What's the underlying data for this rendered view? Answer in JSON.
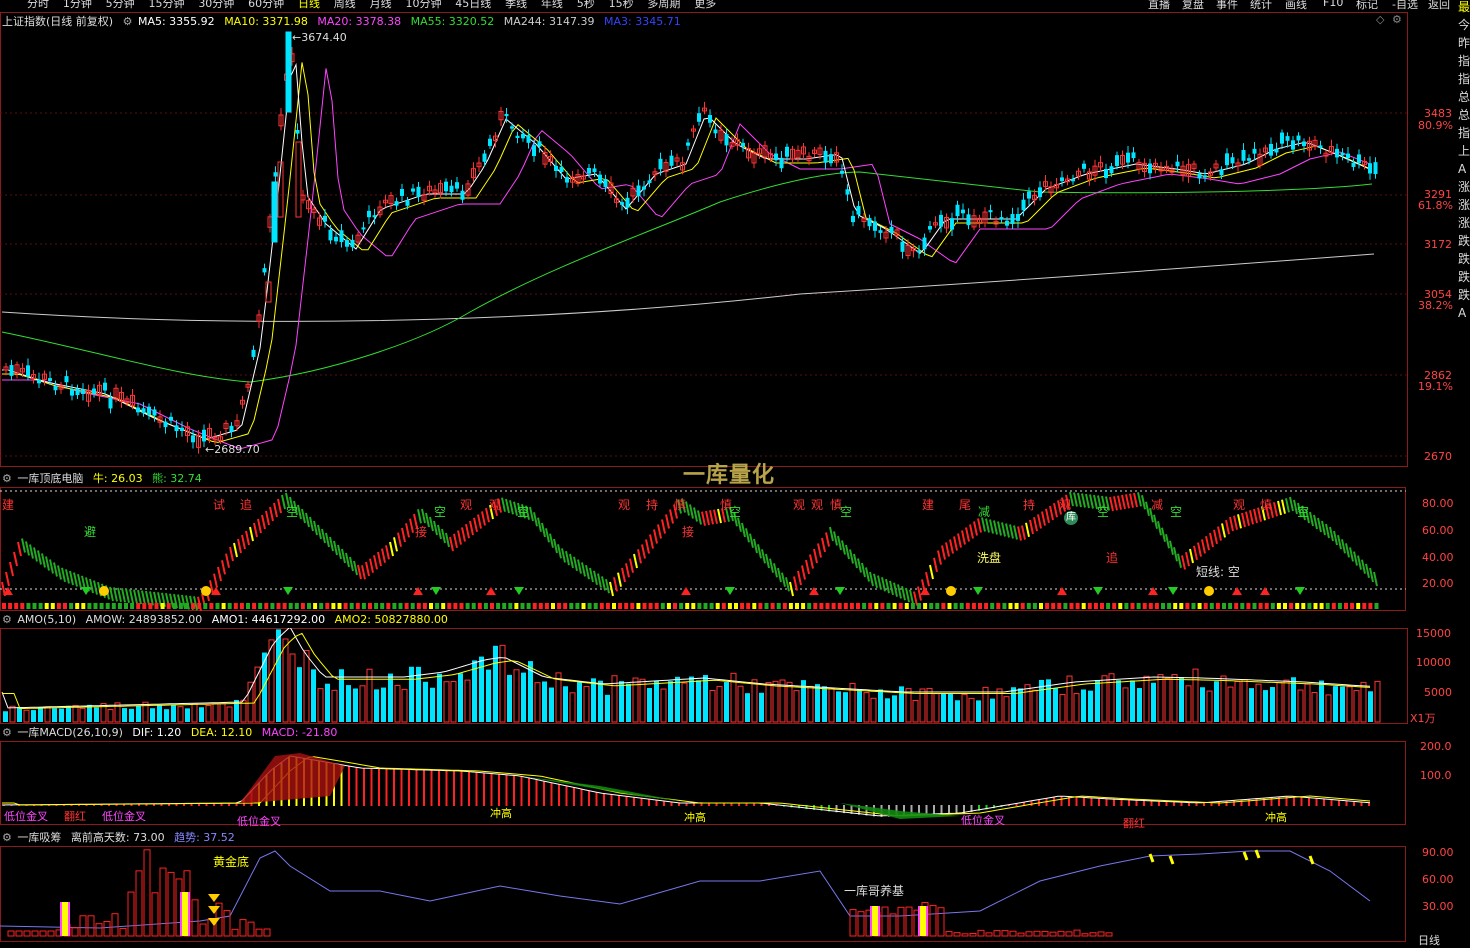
{
  "top_tabs": [
    "分时",
    "1分钟",
    "5分钟",
    "15分钟",
    "30分钟",
    "60分钟",
    "日线",
    "周线",
    "月线",
    "10分钟",
    "45日线",
    "季线",
    "年线",
    "5秒",
    "15秒",
    "多周期",
    "更多"
  ],
  "active_tab": "日线",
  "top_buttons": [
    "直播",
    "复盘",
    "事件",
    "统计",
    "画线",
    "F10",
    "标记",
    "-自选",
    "返回"
  ],
  "main": {
    "title": "上证指数(日线 前复权)",
    "ma": [
      {
        "label": "MA5: 3355.92",
        "color": "#ffffff"
      },
      {
        "label": "MA10: 3371.98",
        "color": "#ffff00"
      },
      {
        "label": "MA20: 3378.38",
        "color": "#ff44ff"
      },
      {
        "label": "MA55: 3320.52",
        "color": "#33dd33"
      },
      {
        "label": "MA244: 3147.39",
        "color": "#cccccc"
      },
      {
        "label": "MA3: 3345.71",
        "color": "#3333ff"
      }
    ],
    "high_label": "3674.40",
    "low_label": "2689.70",
    "price_ticks": [
      "3483",
      "3291",
      "3172",
      "3054",
      "2862",
      "2670"
    ],
    "pct_ticks": [
      "80.9%",
      "61.8%",
      "38.2%",
      "19.1%"
    ]
  },
  "watermark": "一库量化",
  "ind1": {
    "title": "一库顶底电脑",
    "bull": "牛: 26.03",
    "bear": "熊: 32.74",
    "ticks": [
      "80.00",
      "60.00",
      "40.00",
      "20.00"
    ],
    "labels_red": [
      "建",
      "试",
      "追",
      "观",
      "观",
      "持",
      "慎",
      "慎",
      "观",
      "观",
      "慎",
      "建",
      "尾",
      "持",
      "观",
      "减",
      "观",
      "慎"
    ],
    "labels_green": [
      "避",
      "空",
      "空",
      "空",
      "空",
      "空",
      "空",
      "空"
    ],
    "labels_mixed": [
      "接",
      "接",
      "减",
      "库"
    ],
    "wash": "洗盘",
    "chase": "追",
    "short_line": "短线: 空"
  },
  "amo": {
    "title": "AMO(5,10)",
    "amow": "AMOW: 24893852.00",
    "amo1": "AMO1: 44617292.00",
    "amo2": "AMO2: 50827880.00",
    "ticks": [
      "15000",
      "10000",
      "5000"
    ],
    "unit": "X1万"
  },
  "macd": {
    "title": "一库MACD(26,10,9)",
    "dif": "DIF: 1.20",
    "dea": "DEA: 12.10",
    "macd": "MACD: -21.80",
    "ticks": [
      "200.0",
      "100.0"
    ],
    "labels": [
      "低位金叉",
      "翻红",
      "低位金叉",
      "低位金叉",
      "冲高",
      "冲高",
      "低位金叉",
      "翻红",
      "冲高"
    ]
  },
  "chip": {
    "title": "一库吸筹",
    "days": "离前高天数: 73.00",
    "trend": "趋势: 37.52",
    "ticks": [
      "90.00",
      "60.00",
      "30.00"
    ],
    "golden": "黄金底",
    "brother": "一库哥养基"
  },
  "bottom_tab": "日线",
  "right_side": [
    "最",
    "今",
    "昨",
    "指",
    "指",
    "总",
    "总",
    "指",
    "上",
    "A",
    "涨",
    "涨",
    "涨",
    "跌",
    "跌",
    "跌",
    "跌",
    "A"
  ]
}
